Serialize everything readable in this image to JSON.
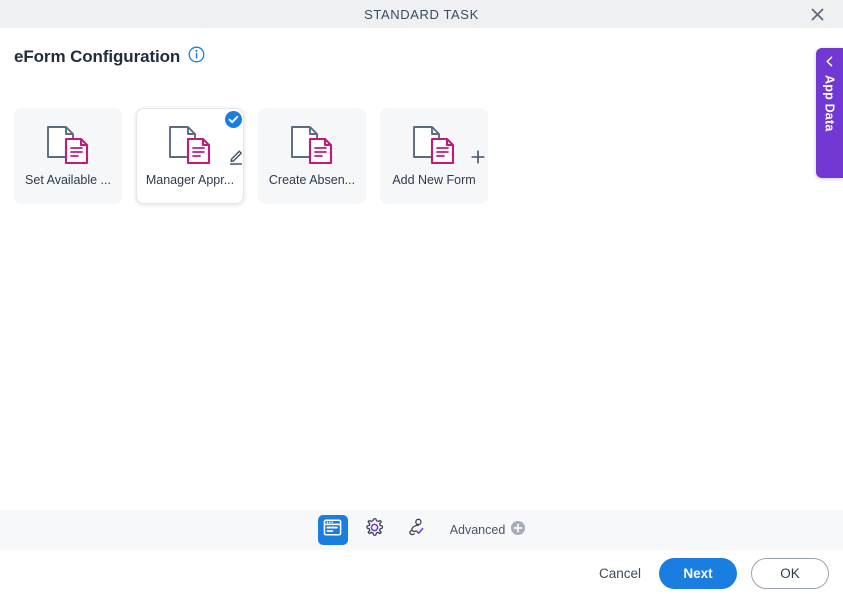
{
  "window": {
    "title": "STANDARD TASK",
    "close_icon": "close-icon"
  },
  "header": {
    "page_title": "eForm Configuration",
    "info_icon": "info-circle-icon"
  },
  "side_tab": {
    "label": "App Data",
    "chevron_icon": "chevron-left-icon",
    "color": "#7138d4"
  },
  "forms": {
    "cards": [
      {
        "label": "Set Available ...",
        "icon": "document-pair-icon",
        "selected": false,
        "badge": ""
      },
      {
        "label": "Manager Appr...",
        "icon": "document-pair-icon",
        "selected": true,
        "badge": "check-circle-icon",
        "edit_icon": "pencil-icon"
      },
      {
        "label": "Create Absen...",
        "icon": "document-pair-icon",
        "selected": false,
        "badge": ""
      },
      {
        "label": "Add New Form",
        "icon": "document-pair-icon",
        "selected": false,
        "badge": "plus-icon"
      }
    ]
  },
  "toolbar": {
    "buttons": [
      {
        "name": "form-designer",
        "icon": "form-window-icon",
        "active": true
      },
      {
        "name": "settings",
        "icon": "gear-icon",
        "active": false
      },
      {
        "name": "participants",
        "icon": "person-check-icon",
        "active": false
      }
    ],
    "advanced_label": "Advanced",
    "advanced_icon": "plus-circle-icon"
  },
  "footer": {
    "cancel_label": "Cancel",
    "next_label": "Next",
    "ok_label": "OK"
  },
  "colors": {
    "accent_blue": "#1a7ee0",
    "accent_purple": "#7138d4",
    "doc_pink": "#c2197e",
    "doc_gray": "#5b6b80"
  }
}
